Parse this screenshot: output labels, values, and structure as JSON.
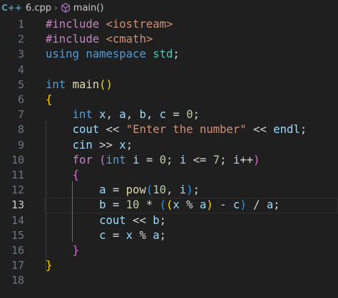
{
  "breadcrumb": {
    "file_icon_text": "C++",
    "file": "6.cpp",
    "symbol": "main()"
  },
  "colors": {
    "background": "#1f1f1f",
    "keyword": "#569cd6",
    "string": "#ce9178",
    "number": "#b5cea8",
    "function": "#dcdcaa",
    "variable": "#9cdcfe",
    "bracket_level_1": "#ffd700",
    "bracket_level_2": "#da70d6",
    "bracket_level_3": "#179fff"
  },
  "editor": {
    "active_line": 13,
    "line_numbers": [
      "1",
      "2",
      "3",
      "4",
      "5",
      "6",
      "7",
      "8",
      "9",
      "10",
      "11",
      "12",
      "13",
      "14",
      "15",
      "16",
      "17",
      "18"
    ],
    "lines": [
      "#include <iostream>",
      "#include <cmath>",
      "using namespace std;",
      "",
      "int main()",
      "{",
      "    int x, a, b, c = 0;",
      "    cout << \"Enter the number\" << endl;",
      "    cin >> x;",
      "    for (int i = 0; i <= 7; i++)",
      "    {",
      "        a = pow(10, i);",
      "        b = 10 * ((x % a) - c) / a;",
      "        cout << b;",
      "        c = x % a;",
      "    }",
      "}",
      ""
    ]
  }
}
